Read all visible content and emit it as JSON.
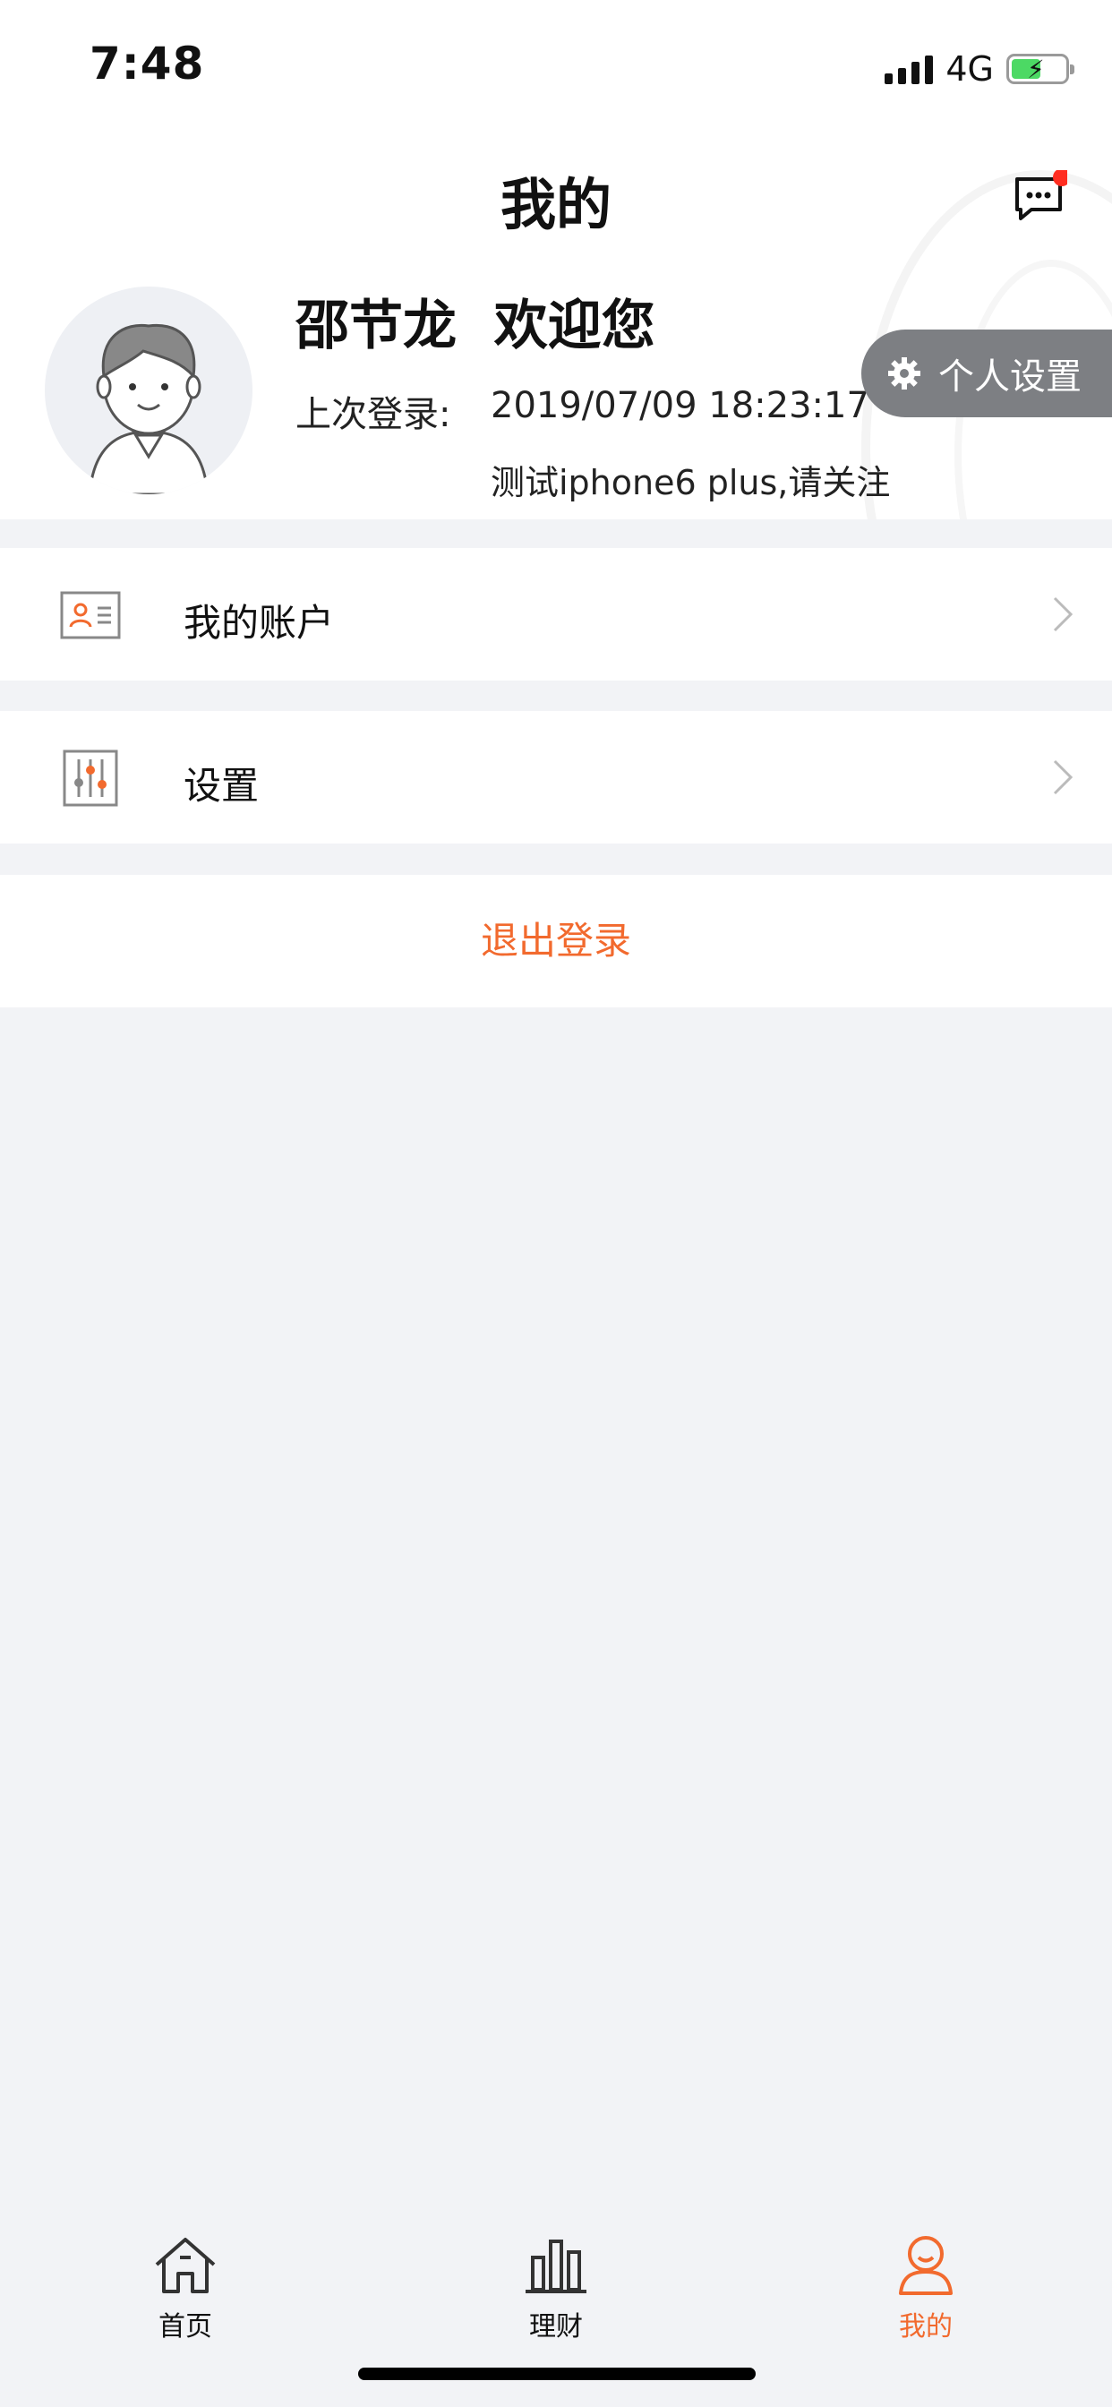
{
  "status_bar": {
    "time": "7:48",
    "network": "4G"
  },
  "header": {
    "title": "我的",
    "message_icon": "chat-bubble-icon"
  },
  "profile": {
    "welcome": "邵节龙  欢迎您",
    "last_login_label": "上次登录:",
    "last_login_time": "2019/07/09 18:23:17",
    "note": "测试iphone6 plus,请关注",
    "settings_button": "个人设置"
  },
  "menu": {
    "items": [
      {
        "label": "我的账户",
        "icon": "id-card-icon"
      },
      {
        "label": "设置",
        "icon": "sliders-icon"
      }
    ],
    "logout_label": "退出登录"
  },
  "tabbar": {
    "tabs": [
      {
        "label": "首页",
        "icon": "home-icon"
      },
      {
        "label": "理财",
        "icon": "bar-chart-icon"
      },
      {
        "label": "我的",
        "icon": "user-icon"
      }
    ],
    "active_index": 2
  },
  "colors": {
    "accent": "#f26a2e",
    "badge": "#ff2d20",
    "pill": "#7d7f83"
  }
}
